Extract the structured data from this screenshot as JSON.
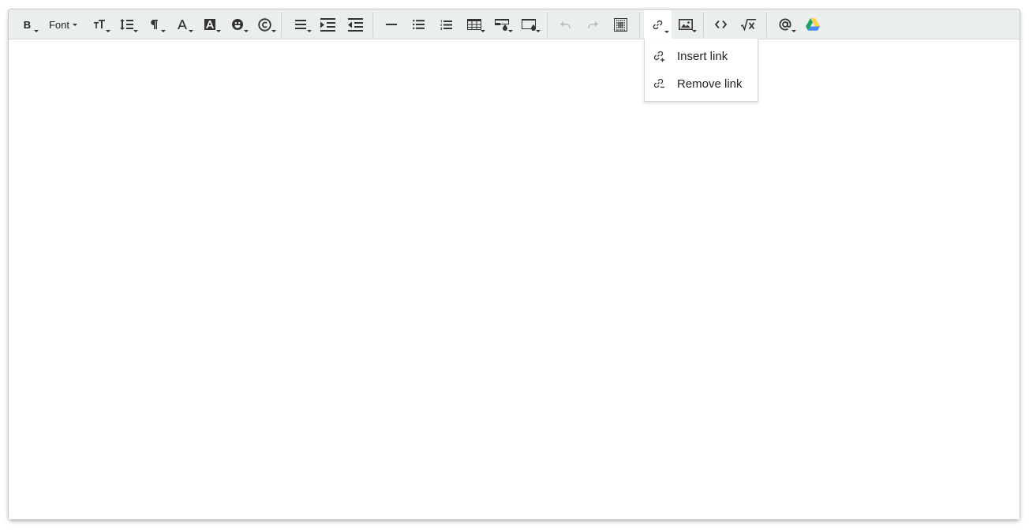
{
  "toolbar": {
    "bold_label": "B",
    "font_label": "Font",
    "buttons": [
      {
        "name": "bold-button",
        "icon": "bold-icon"
      },
      {
        "name": "font-button",
        "icon": "font-family"
      },
      {
        "name": "font-size-button",
        "icon": "font-size-icon"
      },
      {
        "name": "line-height-button",
        "icon": "line-height-icon"
      },
      {
        "name": "paragraph-style-button",
        "icon": "pilcrow-icon"
      },
      {
        "name": "text-color-button",
        "icon": "text-color-icon"
      },
      {
        "name": "background-color-button",
        "icon": "background-color-icon"
      },
      {
        "name": "emoji-button",
        "icon": "emoji-icon"
      },
      {
        "name": "special-characters-button",
        "icon": "copyright-icon"
      },
      {
        "name": "align-button",
        "icon": "align-icon"
      },
      {
        "name": "indent-button",
        "icon": "indent-icon"
      },
      {
        "name": "outdent-button",
        "icon": "outdent-icon"
      },
      {
        "name": "horizontal-line-button",
        "icon": "horizontal-rule-icon"
      },
      {
        "name": "unordered-list-button",
        "icon": "bullet-list-icon"
      },
      {
        "name": "ordered-list-button",
        "icon": "numbered-list-icon"
      },
      {
        "name": "table-button",
        "icon": "table-icon"
      },
      {
        "name": "table-style-button",
        "icon": "table-fill-icon"
      },
      {
        "name": "cell-style-button",
        "icon": "cell-fill-icon"
      },
      {
        "name": "undo-button",
        "icon": "undo-icon"
      },
      {
        "name": "redo-button",
        "icon": "redo-icon"
      },
      {
        "name": "select-all-button",
        "icon": "select-all-icon"
      },
      {
        "name": "link-button",
        "icon": "link-icon"
      },
      {
        "name": "image-button",
        "icon": "image-icon"
      },
      {
        "name": "code-view-button",
        "icon": "code-icon"
      },
      {
        "name": "math-button",
        "icon": "square-root-icon"
      },
      {
        "name": "mention-button",
        "icon": "at-icon"
      },
      {
        "name": "google-drive-button",
        "icon": "google-drive-icon"
      }
    ]
  },
  "link_menu": {
    "items": [
      {
        "label": "Insert link",
        "icon": "insert-link-icon"
      },
      {
        "label": "Remove link",
        "icon": "remove-link-icon"
      }
    ]
  },
  "colors": {
    "toolbar_bg": "#ebeeef",
    "active_bg": "#ffffff",
    "icon": "#333333",
    "disabled_icon": "#bbbbbb",
    "drive_green": "#1fa463",
    "drive_yellow": "#ffd04b",
    "drive_blue": "#4688f4"
  }
}
